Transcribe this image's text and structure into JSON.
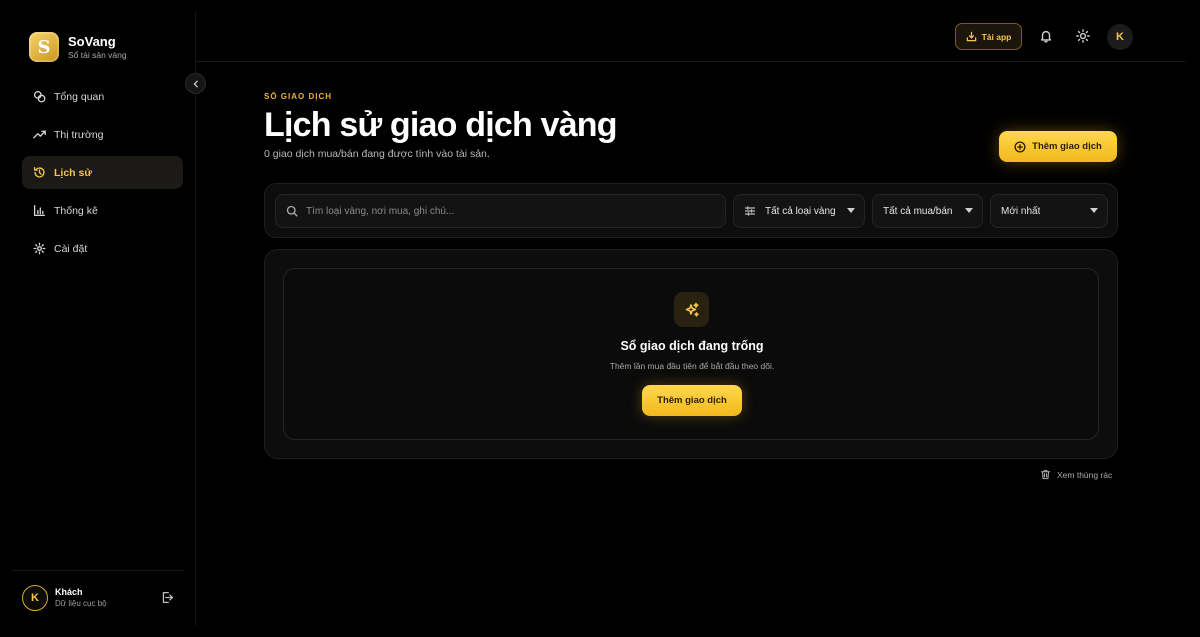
{
  "brand": {
    "logo_letter": "S",
    "name": "SoVang",
    "subtitle": "Sổ tài sản vàng"
  },
  "nav": {
    "items": [
      {
        "label": "Tổng quan",
        "icon": "coins-icon",
        "active": false
      },
      {
        "label": "Thị trường",
        "icon": "trending-up-icon",
        "active": false
      },
      {
        "label": "Lịch sử",
        "icon": "history-icon",
        "active": true
      },
      {
        "label": "Thống kê",
        "icon": "bar-chart-icon",
        "active": false
      },
      {
        "label": "Cài đặt",
        "icon": "gear-icon",
        "active": false
      }
    ]
  },
  "user": {
    "initial": "K",
    "name": "Khách",
    "subtitle": "Dữ liệu cục bộ"
  },
  "topbar": {
    "download_label": "Tải app",
    "avatar_initial": "K"
  },
  "page": {
    "eyebrow": "SỔ GIAO DỊCH",
    "title": "Lịch sử giao dịch vàng",
    "subtitle": "0 giao dịch mua/bán đang được tính vào tài sản.",
    "add_button": "Thêm giao dịch"
  },
  "filters": {
    "search_placeholder": "Tìm loại vàng, nơi mua, ghi chú...",
    "type_selected": "Tất cả loại vàng",
    "side_selected": "Tất cả mua/bán",
    "sort_selected": "Mới nhất"
  },
  "empty_state": {
    "title": "Sổ giao dịch đang trống",
    "subtitle": "Thêm lần mua đầu tiên để bắt đầu theo dõi.",
    "button": "Thêm giao dịch"
  },
  "trash": {
    "label": "Xem thùng rác"
  },
  "colors": {
    "accent": "#F5C451",
    "button_gold": "#F2B91C",
    "background": "#000000"
  }
}
